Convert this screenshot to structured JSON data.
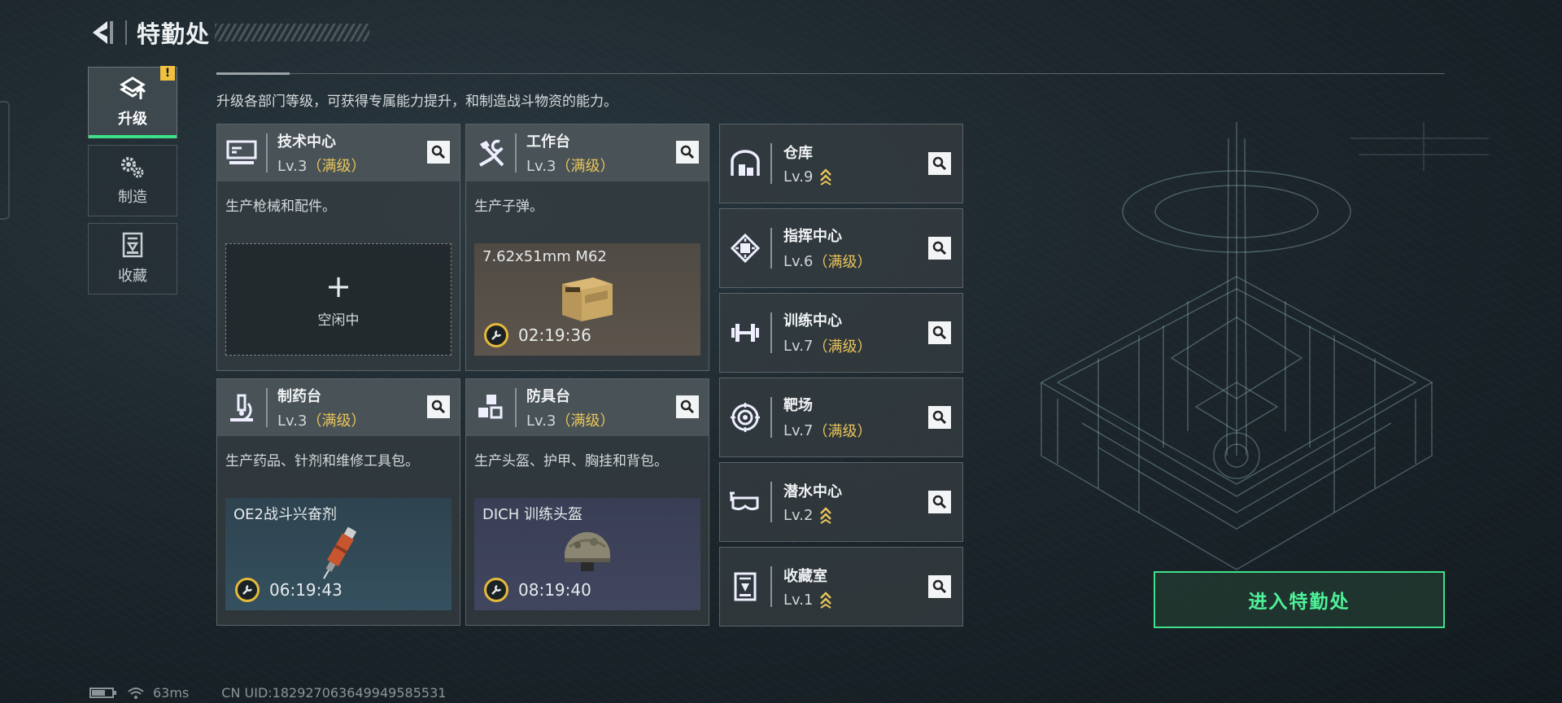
{
  "header": {
    "title": "特勤处",
    "back_icon": "back-arrow-icon"
  },
  "tabs": [
    {
      "label": "升级",
      "icon": "upgrade-icon",
      "active": true,
      "alert": "!"
    },
    {
      "label": "制造",
      "icon": "gears-icon",
      "active": false
    },
    {
      "label": "收藏",
      "icon": "collection-icon",
      "active": false
    }
  ],
  "description": "升级各部门等级，可获得专属能力提升，和制造战斗物资的能力。",
  "cards": [
    {
      "name": "技术中心",
      "level": "Lv.3",
      "max_label": "（满级）",
      "desc": "生产枪械和配件。",
      "icon": "monitor-icon",
      "state": "idle",
      "idle_label": "空闲中"
    },
    {
      "name": "工作台",
      "level": "Lv.3",
      "max_label": "（满级）",
      "desc": "生产子弹。",
      "icon": "tools-icon",
      "state": "producing",
      "product": "7.62x51mm M62",
      "time": "02:19:36",
      "product_icon": "ammo-box-icon"
    },
    {
      "name": "制药台",
      "level": "Lv.3",
      "max_label": "（满级）",
      "desc": "生产药品、针剂和维修工具包。",
      "icon": "microscope-icon",
      "state": "producing",
      "product": "OE2战斗兴奋剂",
      "time": "06:19:43",
      "product_icon": "syringe-icon"
    },
    {
      "name": "防具台",
      "level": "Lv.3",
      "max_label": "（满级）",
      "desc": "生产头盔、护甲、胸挂和背包。",
      "icon": "cubes-icon",
      "state": "producing",
      "product": "DICH 训练头盔",
      "time": "08:19:40",
      "product_icon": "helmet-icon"
    }
  ],
  "list": [
    {
      "name": "仓库",
      "level": "Lv.9",
      "max_label": "",
      "upgradable": true,
      "icon": "warehouse-icon"
    },
    {
      "name": "指挥中心",
      "level": "Lv.6",
      "max_label": "（满级）",
      "upgradable": false,
      "icon": "command-chip-icon"
    },
    {
      "name": "训练中心",
      "level": "Lv.7",
      "max_label": "（满级）",
      "upgradable": false,
      "icon": "dumbbell-icon"
    },
    {
      "name": "靶场",
      "level": "Lv.7",
      "max_label": "（满级）",
      "upgradable": false,
      "icon": "target-icon"
    },
    {
      "name": "潜水中心",
      "level": "Lv.2",
      "max_label": "",
      "upgradable": true,
      "icon": "diving-mask-icon"
    },
    {
      "name": "收藏室",
      "level": "Lv.1",
      "max_label": "",
      "upgradable": true,
      "icon": "collection-room-icon"
    }
  ],
  "enter_button": "进入特勤处",
  "status": {
    "ping": "63ms",
    "uid": "CN UID:182927063649949585531",
    "battery_level": 0.6
  },
  "colors": {
    "accent_green": "#3ee08a",
    "max_gold": "#e9c45a",
    "alert_yellow": "#f0c040"
  }
}
